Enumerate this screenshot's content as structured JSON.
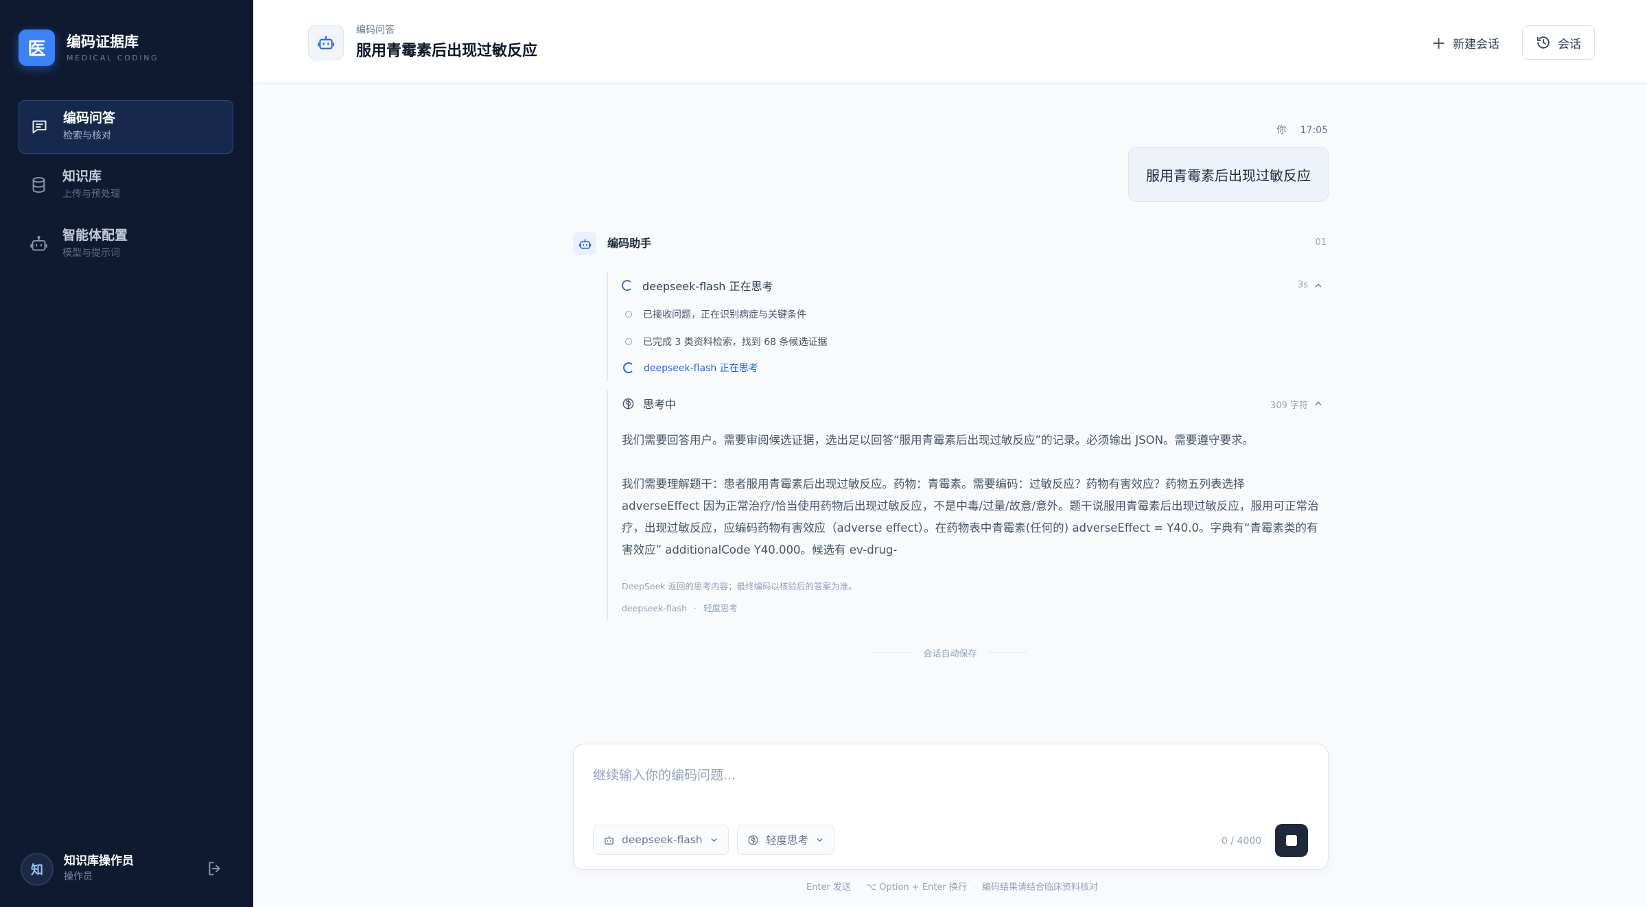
{
  "brand": {
    "logo_char": "医",
    "title": "编码证据库",
    "subtitle": "MEDICAL CODING"
  },
  "nav": [
    {
      "label": "编码问答",
      "sub": "检索与核对",
      "icon": "chat-icon",
      "active": true
    },
    {
      "label": "知识库",
      "sub": "上传与预处理",
      "icon": "database-icon",
      "active": false
    },
    {
      "label": "智能体配置",
      "sub": "模型与提示词",
      "icon": "robot-icon",
      "active": false
    }
  ],
  "user": {
    "avatar_char": "知",
    "name": "知识库操作员",
    "role": "操作员"
  },
  "header": {
    "crumb": "编码问答",
    "title": "服用青霉素后出现过敏反应",
    "new_chat_label": "新建会话",
    "sessions_label": "会话"
  },
  "user_message": {
    "who": "你",
    "time": "17:05",
    "text": "服用青霉素后出现过敏反应"
  },
  "assistant": {
    "name": "编码助手",
    "index": "01",
    "status": {
      "title": "deepseek-flash 正在思考",
      "duration": "3s",
      "steps": [
        {
          "text": "已接收问题，正在识别病症与关键条件",
          "state": "done"
        },
        {
          "text": "已完成 3 类资料检索，找到 68 条候选证据",
          "state": "done"
        },
        {
          "text": "deepseek-flash 正在思考",
          "state": "current"
        }
      ]
    },
    "thinking": {
      "title": "思考中",
      "count": "309 字符",
      "para1": "我们需要回答用户。需要审阅候选证据，选出足以回答“服用青霉素后出现过敏反应”的记录。必须输出 JSON。需要遵守要求。",
      "para2": "我们需要理解题干：患者服用青霉素后出现过敏反应。药物：青霉素。需要编码：过敏反应？药物有害效应？药物五列表选择 adverseEffect 因为正常治疗/恰当使用药物后出现过敏反应，不是中毒/过量/故意/意外。题干说服用青霉素后出现过敏反应，服用可正常治疗，出现过敏反应，应编码药物有害效应（adverse effect）。在药物表中青霉素(任何的) adverseEffect = Y40.0。字典有“青霉素类的有害效应” additionalCode Y40.000。候选有 ev-drug-",
      "note": "DeepSeek 返回的思考内容；最终编码以核验后的答案为准。",
      "model": "deepseek-flash",
      "mode": "轻度思考"
    }
  },
  "autosave": "会话自动保存",
  "composer": {
    "placeholder": "继续输入你的编码问题...",
    "value": "",
    "model_label": "deepseek-flash",
    "mode_label": "轻度思考",
    "char_count": "0 / 4000"
  },
  "hints": {
    "send": "Enter 发送",
    "newline": "⌥ Option + Enter 换行",
    "disclaimer": "编码结果请结合临床资料核对"
  },
  "colors": {
    "sidebar_bg": "#0f1a30",
    "accent": "#3b82f6",
    "active_nav_bg": "#16294c",
    "stop_button": "#1e293b"
  }
}
